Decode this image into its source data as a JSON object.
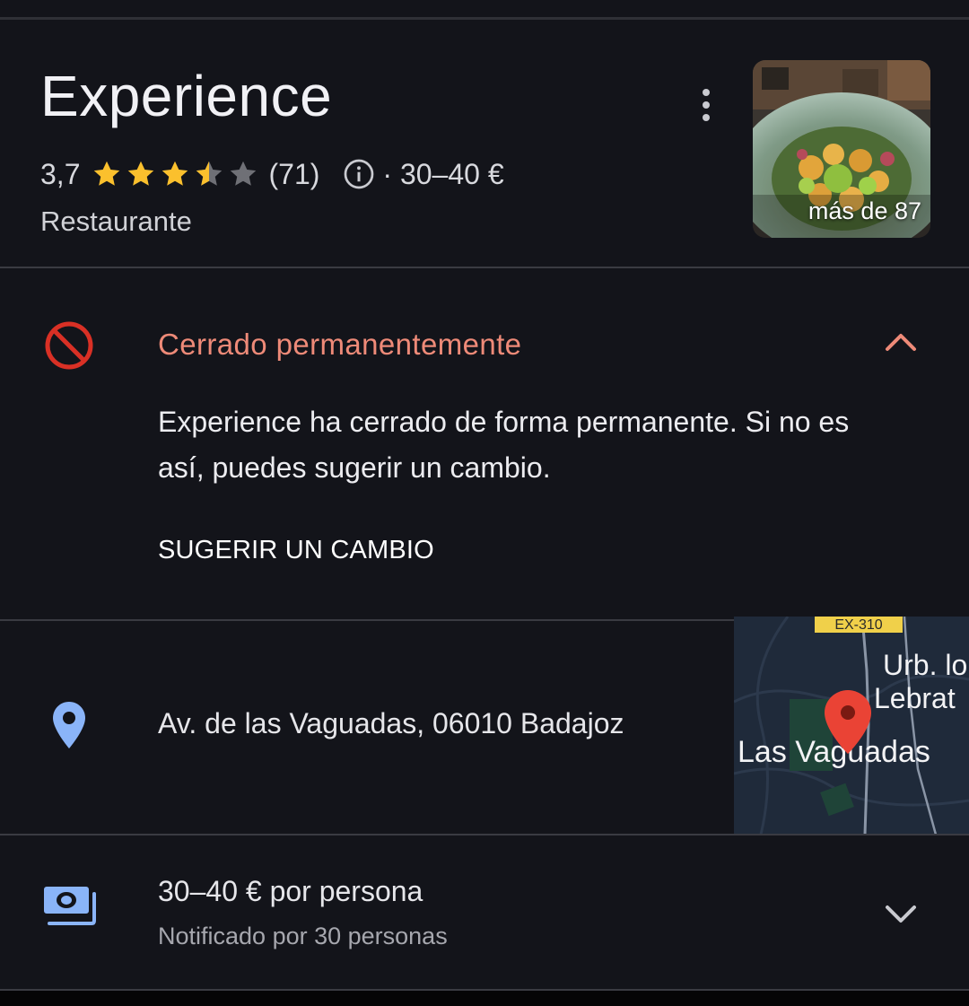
{
  "place": {
    "name": "Experience",
    "rating": "3,7",
    "rating_value": 3.7,
    "review_count": "(71)",
    "price_range": "· 30–40 €",
    "category": "Restaurante",
    "photo_label": "más de 87"
  },
  "status": {
    "title": "Cerrado permanentemente",
    "description": "Experience ha cerrado de forma permanente. Si no es así, puedes sugerir un cambio.",
    "action_label": "SUGERIR UN CAMBIO"
  },
  "address": {
    "text": "Av. de las Vaguadas, 06010 Badajoz"
  },
  "map": {
    "road_label": "EX-310",
    "area_label_1": "Urb. lo",
    "area_label_2": "Lebrat",
    "neighborhood_label": "Las Vaguadas"
  },
  "price_info": {
    "title": "30–40 € por persona",
    "subtitle": "Notificado por 30 personas"
  },
  "colors": {
    "background": "#13141a",
    "star": "#fbc02d",
    "closed_accent": "#ee8a78",
    "closed_icon": "#d93025",
    "link_icon": "#8ab4f8"
  },
  "icons": {
    "closed": "no-entry-icon",
    "location": "map-pin-icon",
    "price": "cash-icon",
    "info": "info-icon",
    "more": "more-vertical-icon",
    "collapse": "chevron-up-icon",
    "expand": "chevron-down-icon"
  }
}
